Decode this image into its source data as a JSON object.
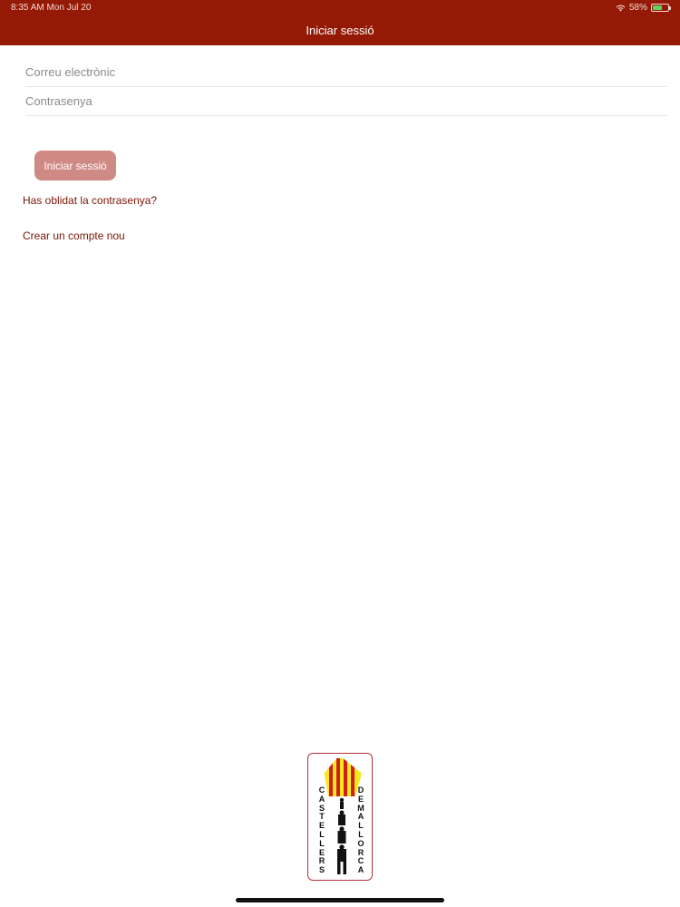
{
  "status_bar": {
    "time": "8:35 AM  Mon Jul 20",
    "battery": "58%"
  },
  "nav": {
    "title": "Iniciar sessió"
  },
  "form": {
    "email_placeholder": "Correu electrònic",
    "password_placeholder": "Contrasenya",
    "login_label": "Iniciar sessió"
  },
  "links": {
    "forgot_password": "Has oblidat la contrasenya?",
    "create_account": "Crear un compte nou"
  },
  "logo": {
    "left_text": "CASTELLERS",
    "right_text": "DE MALLORCA"
  },
  "colors": {
    "nav_bg": "#941a06",
    "button_bg": "#cf8a86",
    "link": "#7a1607"
  }
}
